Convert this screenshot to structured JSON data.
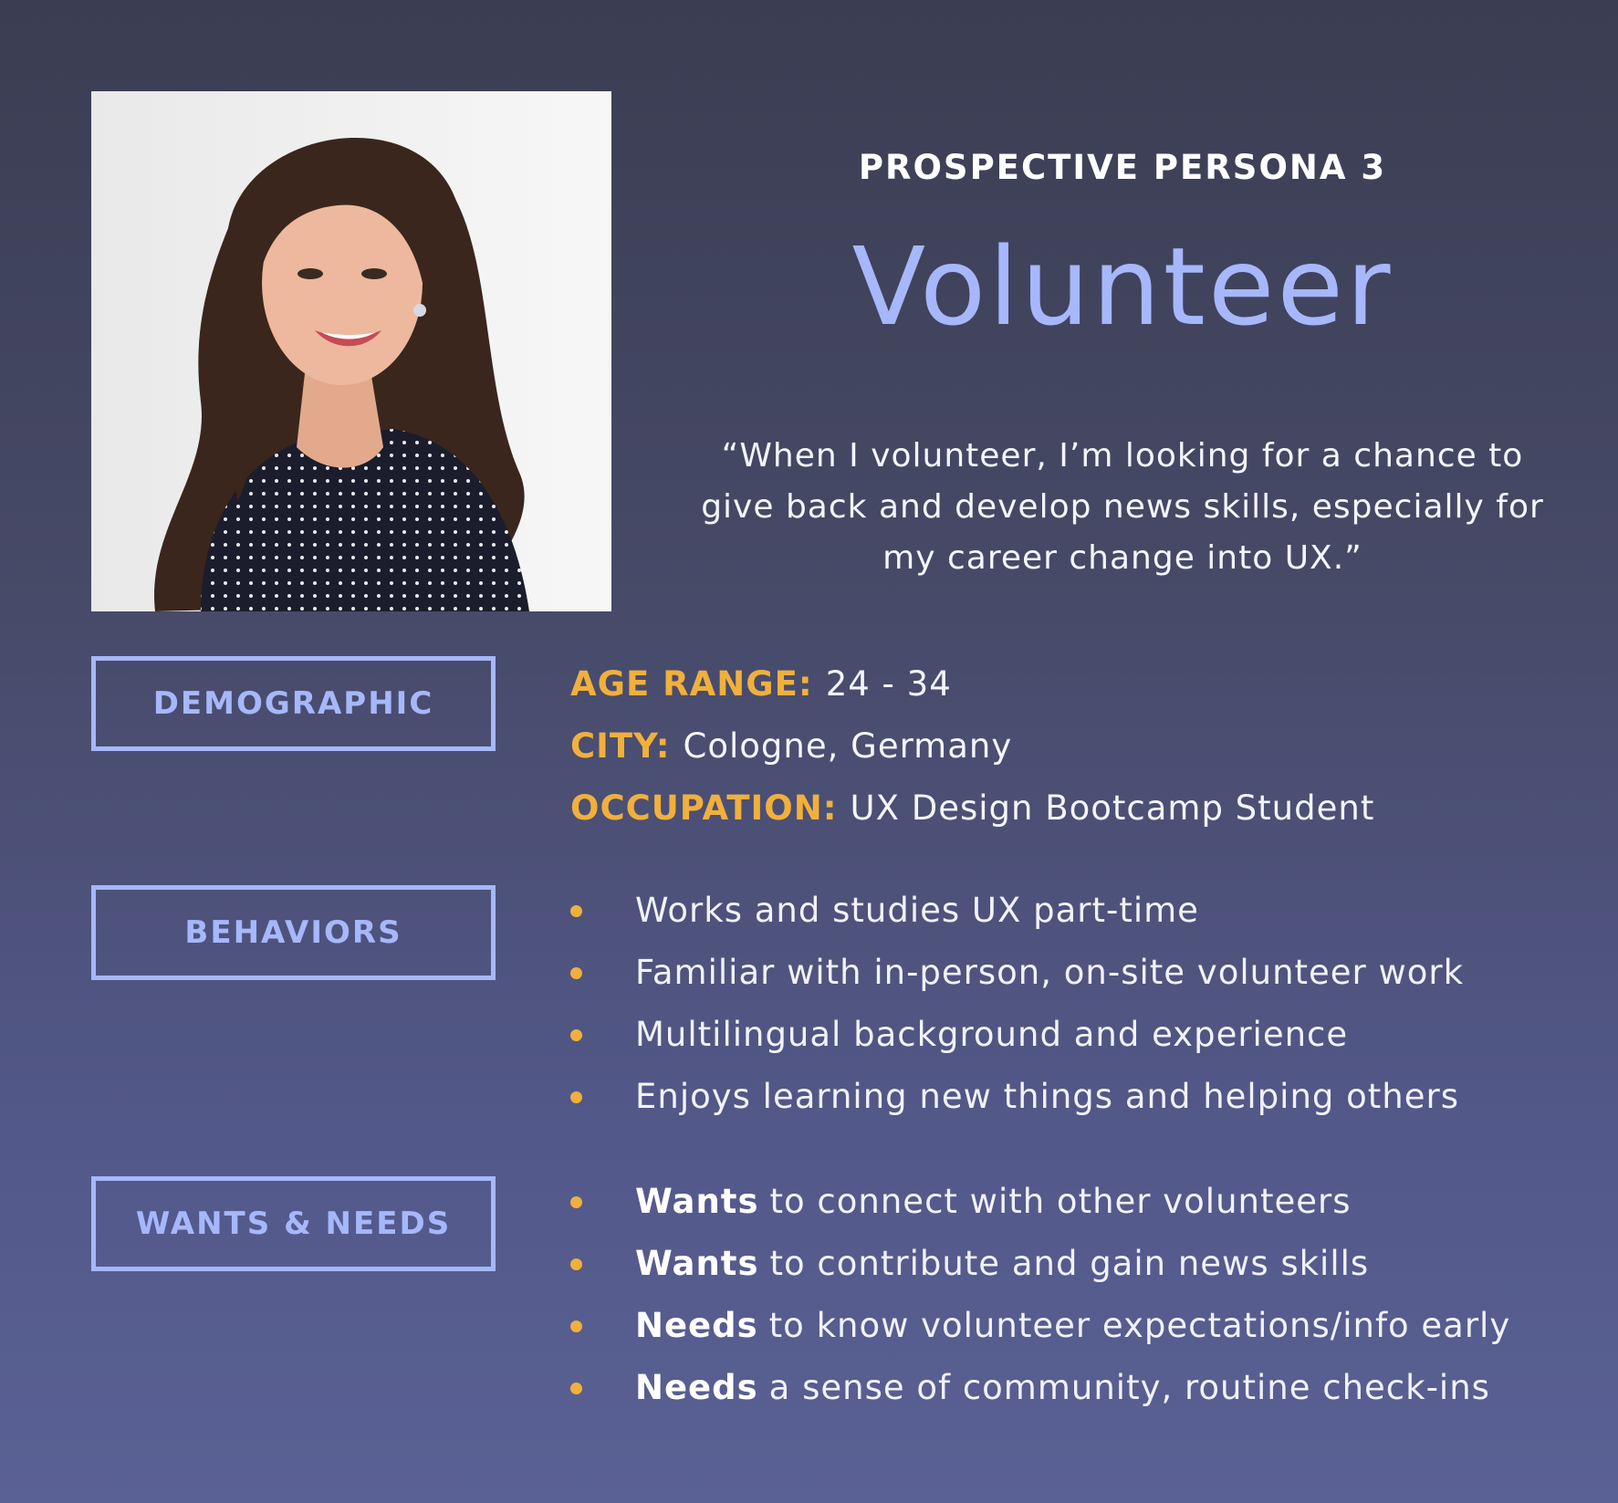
{
  "header": {
    "kicker": "PROSPECTIVE PERSONA 3",
    "title": "Volunteer",
    "quote": "“When I volunteer, I’m looking for a chance to give back and develop news skills, especially for my career change into UX.”"
  },
  "sections": {
    "demographic_label": "DEMOGRAPHIC",
    "behaviors_label": "BEHAVIORS",
    "wants_needs_label": "WANTS & NEEDS"
  },
  "demographics": [
    {
      "key": "AGE RANGE:",
      "value": "24 - 34"
    },
    {
      "key": "CITY:",
      "value": "Cologne, Germany"
    },
    {
      "key": "OCCUPATION:",
      "value": "UX Design Bootcamp Student"
    }
  ],
  "behaviors": [
    "Works and studies UX part-time",
    "Familiar with in-person, on-site volunteer work",
    "Multilingual background and experience",
    "Enjoys learning new things and helping others"
  ],
  "wants_needs": [
    {
      "lead": "Wants",
      "text": "to connect with other volunteers"
    },
    {
      "lead": "Wants",
      "text": "to contribute and gain news skills"
    },
    {
      "lead": "Needs",
      "text": "to know volunteer expectations/info early"
    },
    {
      "lead": "Needs",
      "text": "a sense of community, routine check-ins"
    }
  ],
  "colors": {
    "accent_blue": "#a6b7fb",
    "accent_orange": "#f1b03c",
    "background_top": "#3b3d52",
    "background_bottom": "#5a6194"
  }
}
